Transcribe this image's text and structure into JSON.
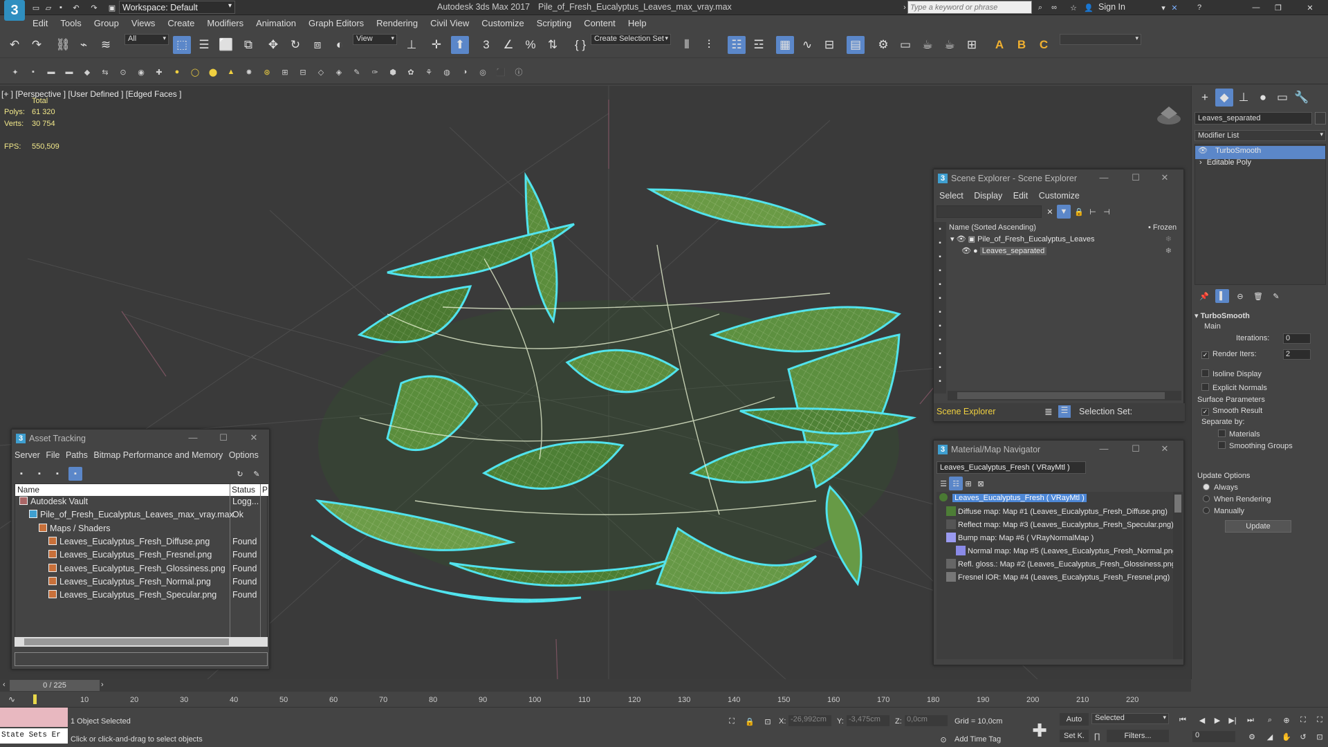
{
  "app": {
    "logo": "3",
    "workspace_label": "Workspace: Default",
    "title": "Autodesk 3ds Max 2017",
    "file": "Pile_of_Fresh_Eucalyptus_Leaves_max_vray.max",
    "search_placeholder": "Type a keyword or phrase",
    "sign_in": "Sign In"
  },
  "menu": [
    "Edit",
    "Tools",
    "Group",
    "Views",
    "Create",
    "Modifiers",
    "Animation",
    "Graph Editors",
    "Rendering",
    "Civil View",
    "Customize",
    "Scripting",
    "Content",
    "Help"
  ],
  "toolbar": {
    "filter_dropdown": "All",
    "view_dropdown": "View",
    "selection_set": "Create Selection Set"
  },
  "viewport": {
    "label": "[+ ] [Perspective ] [User Defined ] [Edged Faces ]",
    "stats_total": "Total",
    "polys_label": "Polys:",
    "polys_value": "61 320",
    "verts_label": "Verts:",
    "verts_value": "30 754",
    "fps_label": "FPS:",
    "fps_value": "550,509"
  },
  "scene_explorer": {
    "title": "Scene Explorer - Scene Explorer",
    "menu": [
      "Select",
      "Display",
      "Edit",
      "Customize"
    ],
    "col_name": "Name (Sorted Ascending)",
    "col_frozen": "• Frozen",
    "items": [
      "Pile_of_Fresh_Eucalyptus_Leaves",
      "Leaves_separated"
    ],
    "footer_label": "Scene Explorer",
    "selection_set": "Selection Set:"
  },
  "asset_tracking": {
    "title": "Asset Tracking",
    "menu": [
      "Server",
      "File",
      "Paths",
      "Bitmap Performance and Memory",
      "Options"
    ],
    "col_name": "Name",
    "col_status": "Status",
    "col_p": "P",
    "rows": [
      {
        "name": "Autodesk Vault",
        "status": "Logg...",
        "indent": 0
      },
      {
        "name": "Pile_of_Fresh_Eucalyptus_Leaves_max_vray.max",
        "status": "Ok",
        "indent": 1
      },
      {
        "name": "Maps / Shaders",
        "status": "",
        "indent": 2
      },
      {
        "name": "Leaves_Eucalyptus_Fresh_Diffuse.png",
        "status": "Found",
        "indent": 3
      },
      {
        "name": "Leaves_Eucalyptus_Fresh_Fresnel.png",
        "status": "Found",
        "indent": 3
      },
      {
        "name": "Leaves_Eucalyptus_Fresh_Glossiness.png",
        "status": "Found",
        "indent": 3
      },
      {
        "name": "Leaves_Eucalyptus_Fresh_Normal.png",
        "status": "Found",
        "indent": 3
      },
      {
        "name": "Leaves_Eucalyptus_Fresh_Specular.png",
        "status": "Found",
        "indent": 3
      }
    ]
  },
  "material_navigator": {
    "title": "Material/Map Navigator",
    "field": "Leaves_Eucalyptus_Fresh  ( VRayMtl )",
    "root": "Leaves_Eucalyptus_Fresh  ( VRayMtl )",
    "maps": [
      "Diffuse map: Map #1 (Leaves_Eucalyptus_Fresh_Diffuse.png)",
      "Reflect map: Map #3 (Leaves_Eucalyptus_Fresh_Specular.png)",
      "Bump map: Map #6  ( VRayNormalMap )",
      "Normal map: Map #5 (Leaves_Eucalyptus_Fresh_Normal.png)",
      "Refl. gloss.: Map #2 (Leaves_Eucalyptus_Fresh_Glossiness.png)",
      "Fresnel IOR: Map #4 (Leaves_Eucalyptus_Fresh_Fresnel.png)"
    ]
  },
  "command_panel": {
    "object_name": "Leaves_separated",
    "modifier_list": "Modifier List",
    "stack": [
      "TurboSmooth",
      "Editable Poly"
    ],
    "rollout_title": "TurboSmooth",
    "main_label": "Main",
    "iterations_label": "Iterations:",
    "iterations_value": "0",
    "render_iters_label": "Render Iters:",
    "render_iters_value": "2",
    "isoline": "Isoline Display",
    "explicit_normals": "Explicit Normals",
    "surface_params": "Surface Parameters",
    "smooth_result": "Smooth Result",
    "separate_by": "Separate by:",
    "materials": "Materials",
    "smoothing_groups": "Smoothing Groups",
    "update_options": "Update Options",
    "always": "Always",
    "when_rendering": "When Rendering",
    "manually": "Manually",
    "update_button": "Update"
  },
  "timeline": {
    "frame_counter": "0 / 225",
    "ticks": [
      "10",
      "20",
      "30",
      "40",
      "50",
      "60",
      "70",
      "80",
      "90",
      "100",
      "110",
      "120",
      "130",
      "140",
      "150",
      "160",
      "170",
      "180",
      "190",
      "200",
      "210",
      "220"
    ]
  },
  "status": {
    "maxscript": "State Sets Er",
    "selected": "1 Object Selected",
    "prompt": "Click or click-and-drag to select objects",
    "x_label": "X:",
    "x_value": "-26,992cm",
    "y_label": "Y:",
    "y_value": "-3,475cm",
    "z_label": "Z:",
    "z_value": "0,0cm",
    "grid": "Grid = 10,0cm",
    "add_time_tag": "Add Time Tag",
    "auto": "Auto",
    "set_key": "Set K.",
    "selected_dropdown": "Selected",
    "filters": "Filters...",
    "frame_field": "0"
  }
}
